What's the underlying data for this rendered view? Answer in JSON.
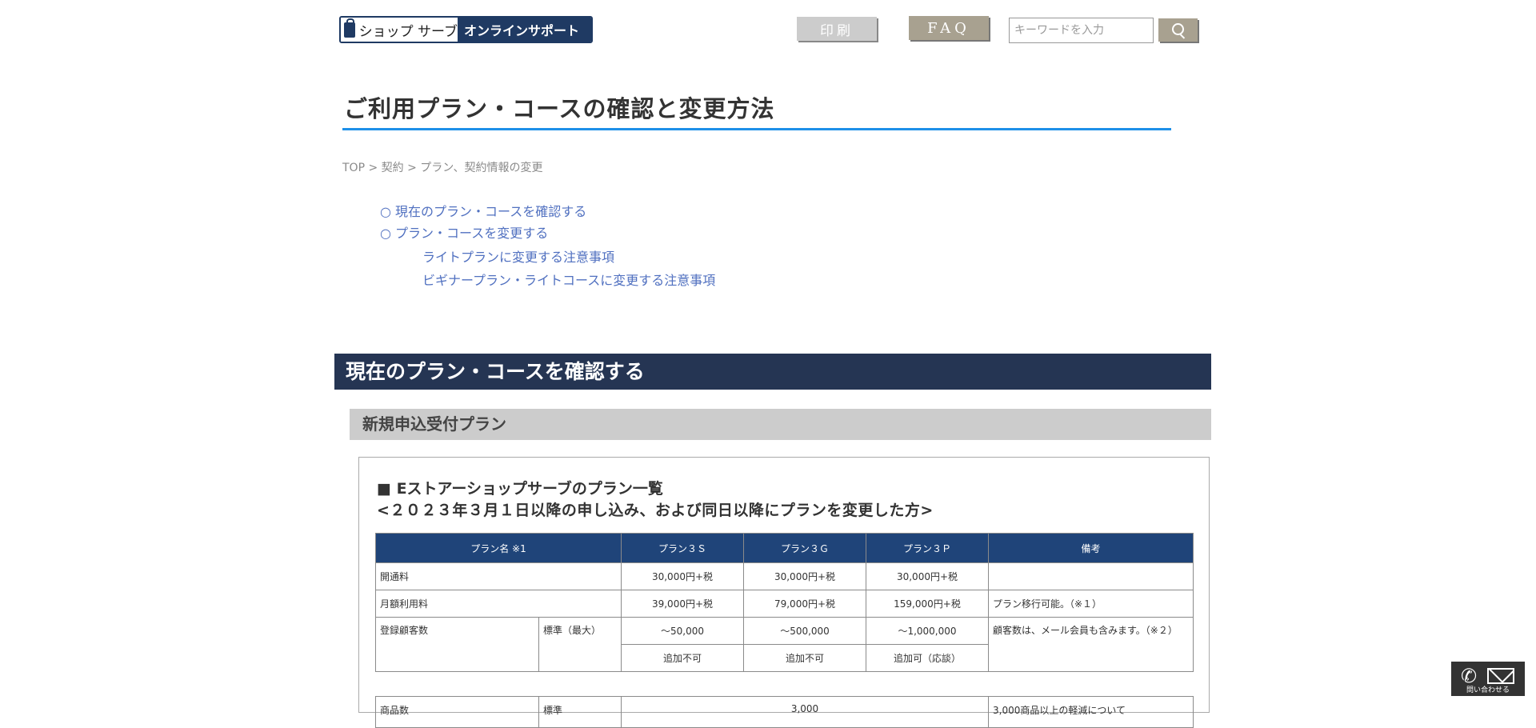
{
  "header": {
    "logo_left": "ショップ サーブ",
    "logo_right": "オンラインサポート",
    "print_label": "印刷",
    "faq_label": "FAQ",
    "search_placeholder": "キーワードを入力"
  },
  "page_title": "ご利用プラン・コースの確認と変更方法",
  "breadcrumb": [
    "TOP",
    "契約",
    "プラン、契約情報の変更"
  ],
  "toc": [
    "○ 現在のプラン・コースを確認する",
    "○ プラン・コースを変更する",
    "ライトプランに変更する注意事項",
    "ビギナープラン・ライトコースに変更する注意事項"
  ],
  "section_title": "現在のプラン・コースを確認する",
  "subsection_title": "新規申込受付プラン",
  "box": {
    "heading1": "■ Eストアーショップサーブのプラン一覧",
    "heading2": "<２０２３年３月１日以降の申し込み、および同日以降にプランを変更した方>"
  },
  "table": {
    "headers": [
      "プラン名 ※1",
      "プラン３Ｓ",
      "プラン３Ｇ",
      "プラン３Ｐ",
      "備考"
    ],
    "rows": {
      "setup": {
        "label": "開通料",
        "values": [
          "30,000円+税",
          "30,000円+税",
          "30,000円+税"
        ],
        "note": ""
      },
      "monthly": {
        "label": "月額利用料",
        "values": [
          "39,000円+税",
          "79,000円+税",
          "159,000円+税"
        ],
        "note": "プラン移行可能。（※１）"
      },
      "customers": {
        "label": "登録顧客数",
        "sub": "標準（最大）",
        "values": [
          "〜50,000",
          "〜500,000",
          "〜1,000,000"
        ],
        "add": [
          "追加不可",
          "追加不可",
          "追加可（応談）"
        ],
        "note": "顧客数は、メール会員も含みます。（※２）"
      },
      "products": {
        "label": "商品数",
        "sub": "標準",
        "value": "3,000",
        "note": "3,000商品以上の軽減について"
      }
    }
  },
  "contact": {
    "label": "問い合わせる"
  }
}
